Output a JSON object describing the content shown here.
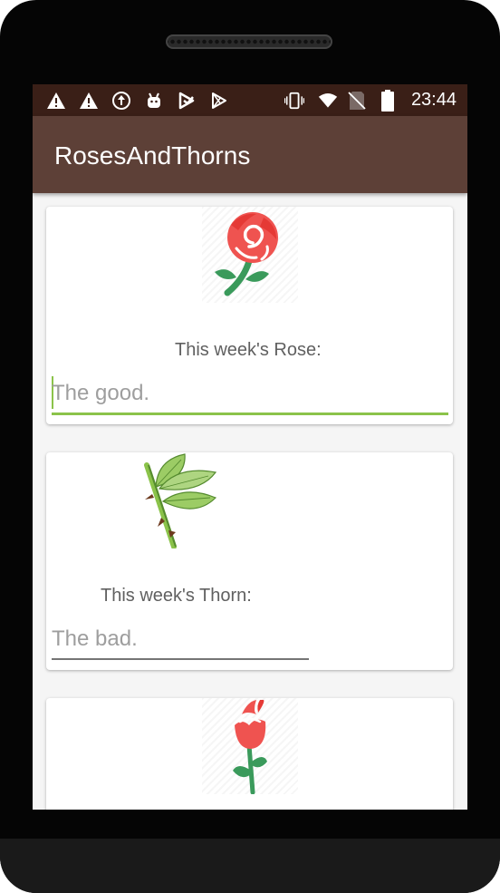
{
  "status_bar": {
    "icons": [
      "warning-icon",
      "warning-icon",
      "sync-icon",
      "android-debug-icon",
      "play-store-icon",
      "play-icon",
      "vibrate-icon",
      "wifi-icon",
      "no-sim-icon",
      "battery-icon"
    ],
    "time": "23:44",
    "color": "#3a1f17"
  },
  "app_bar": {
    "title": "RosesAndThorns",
    "color": "#5d4037"
  },
  "cards": [
    {
      "image_icon": "rose-icon",
      "label": "This week's Rose:",
      "placeholder": "The good.",
      "focused": true,
      "accent": "#8bc34a"
    },
    {
      "image_icon": "thorn-leaf-icon",
      "label": "This week's Thorn:",
      "placeholder": "The bad.",
      "focused": false
    },
    {
      "image_icon": "rosebud-icon"
    }
  ]
}
